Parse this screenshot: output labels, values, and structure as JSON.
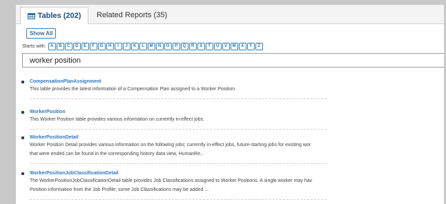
{
  "tabs": [
    {
      "label": "Tables (202)",
      "active": true
    },
    {
      "label": "Related Reports (35)",
      "active": false
    }
  ],
  "filter": {
    "show_all_label": "Show All",
    "starts_with_label": "Starts with:",
    "letters": [
      "A",
      "B",
      "C",
      "D",
      "E",
      "F",
      "G",
      "H",
      "I",
      "J",
      "K",
      "L",
      "M",
      "N",
      "O",
      "P",
      "Q",
      "R",
      "S",
      "T",
      "U",
      "V",
      "W",
      "X",
      "Y",
      "Z"
    ]
  },
  "search": {
    "value": "worker position"
  },
  "results": [
    {
      "title": "CompensationPlanAssignment",
      "desc": [
        "This table provides the latest information of a Compensation Plan assigned to a Worker Position."
      ]
    },
    {
      "title": "WorkerPosition",
      "desc": [
        "This Worker Position table provides various information on currently in-effect jobs."
      ]
    },
    {
      "title": "WorkerPositionDetail",
      "desc": [
        "Worker Position Detail provides various information on the following jobs; currently in-effect jobs, future-starting jobs for existing wor",
        "that were ended can be found in the corresponding history data view, HumanRe..."
      ]
    },
    {
      "title": "WorkerPositionJobClassificationDetail",
      "desc": [
        "The WorkerPositionJobClassificationDetail table provides Job Classifications assigned to Worker Positions. A single worker may hav",
        "Position information from the Job Profile; some Job Classifications may be added ..."
      ]
    }
  ],
  "colors": {
    "accent": "#2f78c0",
    "tab_text": "#1f4f7a"
  }
}
